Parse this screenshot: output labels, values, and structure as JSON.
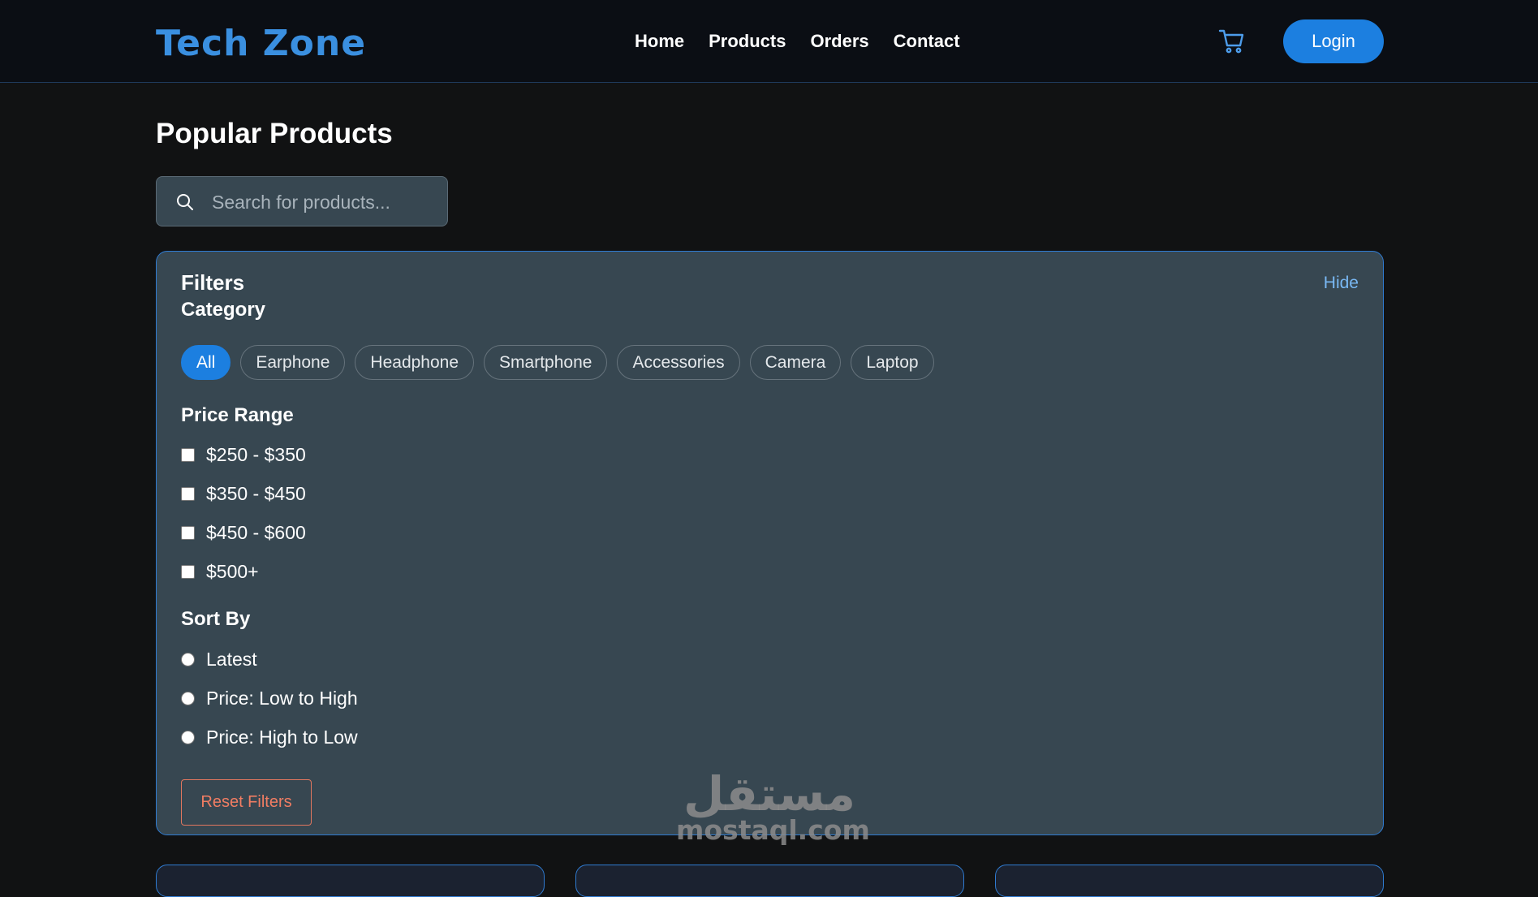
{
  "header": {
    "logo": "Tech Zone",
    "nav": [
      "Home",
      "Products",
      "Orders",
      "Contact"
    ],
    "cart_icon": "cart-icon",
    "login_label": "Login"
  },
  "main": {
    "title": "Popular Products",
    "search": {
      "placeholder": "Search for products...",
      "value": "",
      "icon": "search-icon"
    }
  },
  "filters": {
    "title": "Filters",
    "hide_label": "Hide",
    "category": {
      "label": "Category",
      "options": [
        "All",
        "Earphone",
        "Headphone",
        "Smartphone",
        "Accessories",
        "Camera",
        "Laptop"
      ],
      "selected": "All"
    },
    "price": {
      "label": "Price Range",
      "options": [
        "$250 - $350",
        "$350 - $450",
        "$450 - $600",
        "$500+"
      ]
    },
    "sort": {
      "label": "Sort By",
      "options": [
        "Latest",
        "Price: Low to High",
        "Price: High to Low"
      ]
    },
    "reset_label": "Reset Filters"
  },
  "watermark": {
    "arabic": "مستقل",
    "latin": "mostaql.com"
  },
  "colors": {
    "accent": "#1c7fe0",
    "logo": "#3a8fe0",
    "panel": "#374751",
    "reset": "#f07d63",
    "link": "#79b8f3"
  }
}
